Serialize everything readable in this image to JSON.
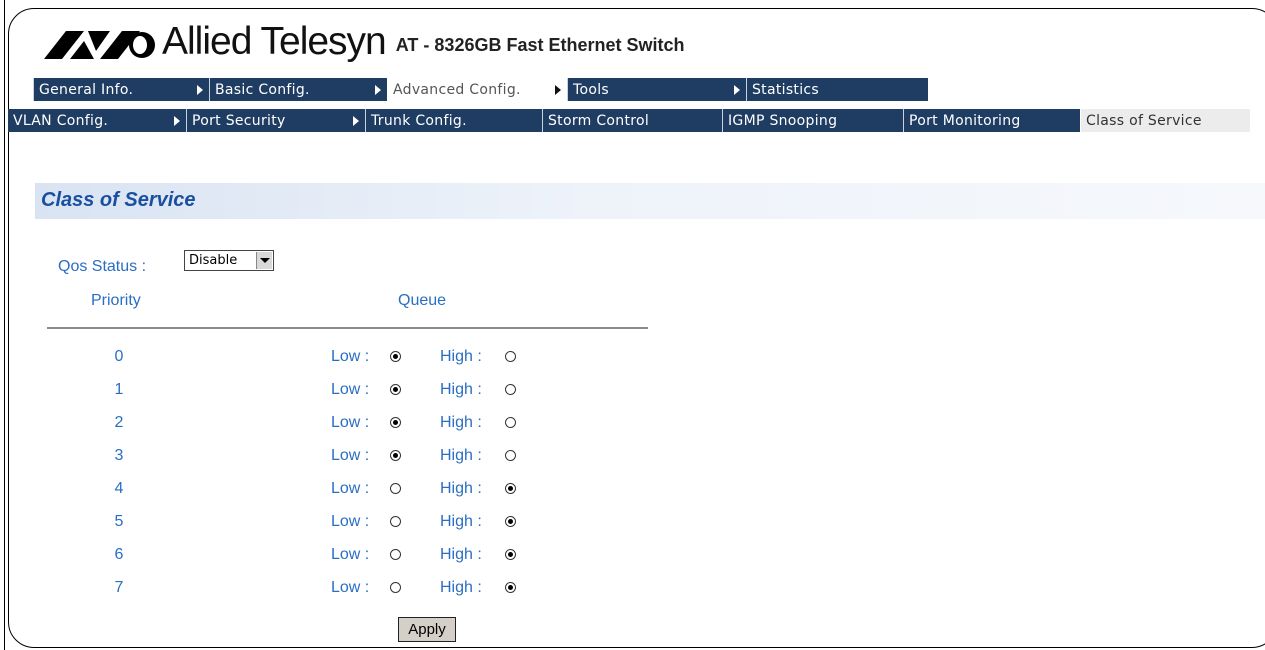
{
  "header": {
    "brand": "Allied Telesyn",
    "model": "AT - 8326GB Fast Ethernet Switch",
    "logo_icon": "allied-telesyn-logo-icon"
  },
  "menu_primary": [
    {
      "label": "General Info.",
      "arrow": true,
      "active": false
    },
    {
      "label": "Basic Config.",
      "arrow": true,
      "active": false
    },
    {
      "label": "Advanced Config.",
      "arrow": true,
      "active": true
    },
    {
      "label": "Tools",
      "arrow": true,
      "active": false
    },
    {
      "label": "Statistics",
      "arrow": false,
      "active": false
    }
  ],
  "menu_secondary": [
    {
      "label": "VLAN Config.",
      "arrow": true,
      "active": false
    },
    {
      "label": "Port Security",
      "arrow": true,
      "active": false
    },
    {
      "label": "Trunk Config.",
      "arrow": false,
      "active": false
    },
    {
      "label": "Storm Control",
      "arrow": false,
      "active": false
    },
    {
      "label": "IGMP Snooping",
      "arrow": false,
      "active": false
    },
    {
      "label": "Port Monitoring",
      "arrow": false,
      "active": false
    },
    {
      "label": "Class of Service",
      "arrow": false,
      "active": true
    }
  ],
  "page": {
    "title": "Class of Service",
    "qos_label": "Qos Status :",
    "qos_value": "Disable",
    "col_priority": "Priority",
    "col_queue": "Queue",
    "low_label": "Low :",
    "high_label": "High :",
    "apply_label": "Apply"
  },
  "priorities": [
    {
      "priority": "0",
      "queue": "low"
    },
    {
      "priority": "1",
      "queue": "low"
    },
    {
      "priority": "2",
      "queue": "low"
    },
    {
      "priority": "3",
      "queue": "low"
    },
    {
      "priority": "4",
      "queue": "high"
    },
    {
      "priority": "5",
      "queue": "high"
    },
    {
      "priority": "6",
      "queue": "high"
    },
    {
      "priority": "7",
      "queue": "high"
    }
  ],
  "colors": {
    "nav_bg": "#1f3d63",
    "label_blue": "#2a6ec3",
    "title_blue": "#1a4fa0"
  }
}
